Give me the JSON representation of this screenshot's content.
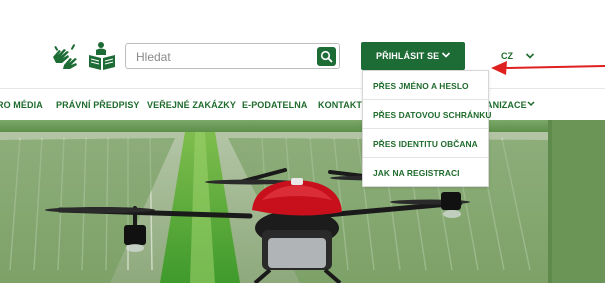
{
  "header": {
    "search": {
      "placeholder": "Hledat"
    },
    "login": {
      "label": "PŘIHLÁSIT SE"
    },
    "language": {
      "current": "CZ"
    }
  },
  "nav": {
    "items": [
      {
        "label": "RO MÉDIA"
      },
      {
        "label": "PRÁVNÍ PŘEDPISY"
      },
      {
        "label": "VEŘEJNÉ ZAKÁZKY"
      },
      {
        "label": "E-PODATELNA"
      },
      {
        "label": "KONTAKTY"
      },
      {
        "label": "ANIZACE"
      }
    ]
  },
  "login_menu": {
    "items": [
      {
        "label": "PŘES JMÉNO A HESLO"
      },
      {
        "label": "PŘES DATOVOU SCHRÁNKU"
      },
      {
        "label": "PŘES IDENTITU OBČANA"
      },
      {
        "label": "JAK NA REGISTRACI"
      }
    ]
  },
  "icons": {
    "sign_language": "sign-language-icon",
    "easy_read": "easy-read-icon",
    "search": "search-icon",
    "chevron": "chevron-down-icon",
    "annotation_arrow": "red-arrow-icon"
  },
  "colors": {
    "brand_green": "#1d6b35",
    "text_green": "#1e6b2c",
    "annotation_red": "#e02020"
  }
}
